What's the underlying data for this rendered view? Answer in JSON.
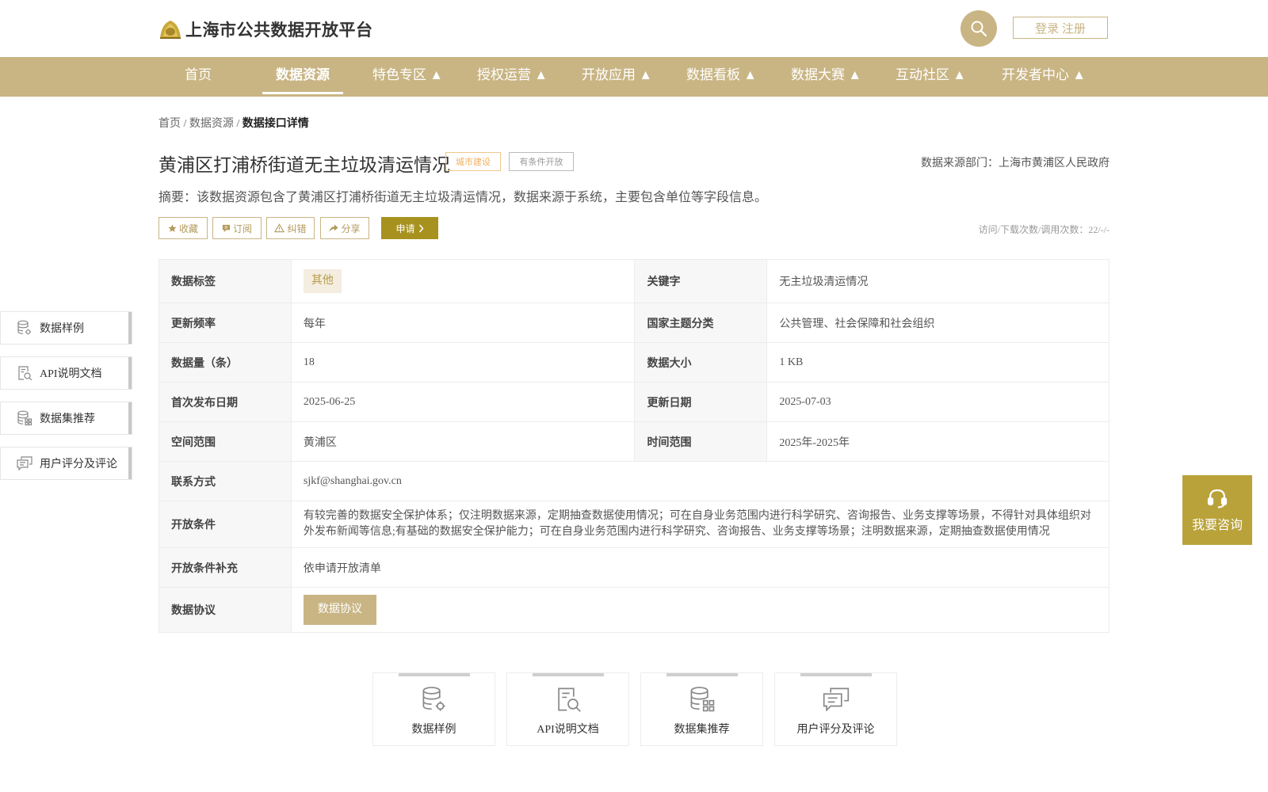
{
  "header": {
    "site_title": "上海市公共数据开放平台",
    "login_label": "登录 注册"
  },
  "nav": {
    "items": [
      {
        "label": "首页"
      },
      {
        "label": "数据资源"
      },
      {
        "label": "特色专区 ▲"
      },
      {
        "label": "授权运营 ▲"
      },
      {
        "label": "开放应用 ▲"
      },
      {
        "label": "数据看板 ▲"
      },
      {
        "label": "数据大赛 ▲"
      },
      {
        "label": "互动社区 ▲"
      },
      {
        "label": "开发者中心 ▲"
      }
    ],
    "active_index": 1
  },
  "breadcrumb": {
    "home": "首页",
    "sep1": "/",
    "resources": "数据资源",
    "sep2": "/",
    "current": "数据接口详情"
  },
  "dataset": {
    "title": "黄浦区打浦桥街道无主垃圾清运情况",
    "tag_category": "城市建设",
    "tag_open_type": "有条件开放",
    "source": "数据来源部门：上海市黄浦区人民政府",
    "summary": "摘要：该数据资源包含了黄浦区打浦桥街道无主垃圾清运情况，数据来源于系统，主要包含单位等字段信息。",
    "visits": "访问/下载次数/调用次数：22/-/-"
  },
  "actions": {
    "favorite": "收藏",
    "subscribe": "订阅",
    "report": "纠错",
    "share": "分享",
    "apply": "申请"
  },
  "info": {
    "tag_label": "数据标签",
    "tag_value": "其他",
    "keyword_label": "关键字",
    "keyword_value": "无主垃圾清运情况",
    "freq_label": "更新频率",
    "freq_value": "每年",
    "theme_label": "国家主题分类",
    "theme_value": "公共管理、社会保障和社会组织",
    "count_label": "数据量（条）",
    "count_value": "18",
    "size_label": "数据大小",
    "size_value": "1 KB",
    "first_pub_label": "首次发布日期",
    "first_pub_value": "2025-06-25",
    "update_label": "更新日期",
    "update_value": "2025-07-03",
    "space_label": "空间范围",
    "space_value": "黄浦区",
    "time_label": "时间范围",
    "time_value": "2025年-2025年",
    "contact_label": "联系方式",
    "contact_value": "sjkf@shanghai.gov.cn",
    "cond_label": "开放条件",
    "cond_value": "有较完善的数据安全保护体系；仅注明数据来源，定期抽查数据使用情况；可在自身业务范围内进行科学研究、咨询报告、业务支撑等场景，不得针对具体组织对外发布新闻等信息;有基础的数据安全保护能力；可在自身业务范围内进行科学研究、咨询报告、业务支撑等场景；注明数据来源，定期抽查数据使用情况",
    "cond_extra_label": "开放条件补充",
    "cond_extra_value": "依申请开放清单",
    "agreement_label": "数据协议",
    "agreement_button": "数据协议"
  },
  "side_nav": [
    {
      "label": "数据样例",
      "icon": "database-gear-icon"
    },
    {
      "label": "API说明文档",
      "icon": "document-search-icon"
    },
    {
      "label": "数据集推荐",
      "icon": "database-grid-icon"
    },
    {
      "label": "用户评分及评论",
      "icon": "comments-icon"
    }
  ],
  "consult": {
    "label": "我要咨询",
    "icon": "headset-icon"
  },
  "bottom_cards": [
    {
      "label": "数据样例",
      "icon": "database-gear-icon"
    },
    {
      "label": "API说明文档",
      "icon": "document-search-icon"
    },
    {
      "label": "数据集推荐",
      "icon": "database-grid-icon"
    },
    {
      "label": "用户评分及评论",
      "icon": "comments-icon"
    }
  ],
  "colors": {
    "brand_gold": "#c9b584",
    "apply_olive": "#a8921f",
    "consult_gold": "#b9a23a",
    "tag_orange": "#f0b060"
  }
}
